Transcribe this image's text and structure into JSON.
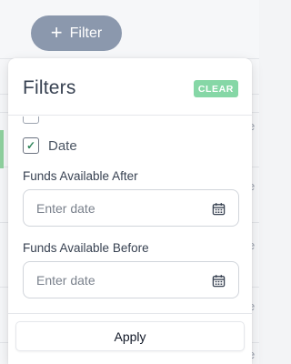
{
  "toolbar": {
    "filter_button_label": "Filter"
  },
  "filters_panel": {
    "title": "Filters",
    "clear_label": "CLEAR",
    "date_checkbox": {
      "label": "Date",
      "checked": true
    },
    "funds_after": {
      "label": "Funds Available After",
      "placeholder": "Enter date"
    },
    "funds_before": {
      "label": "Funds Available Before",
      "placeholder": "Enter date"
    },
    "apply_label": "Apply"
  },
  "background": {
    "column_letter": "e"
  },
  "colors": {
    "filter_button": "#8b98ad",
    "clear_button": "#86d7a6",
    "check_mark": "#2f855a"
  },
  "icons": [
    "plus-icon",
    "check-icon",
    "calendar-icon"
  ]
}
